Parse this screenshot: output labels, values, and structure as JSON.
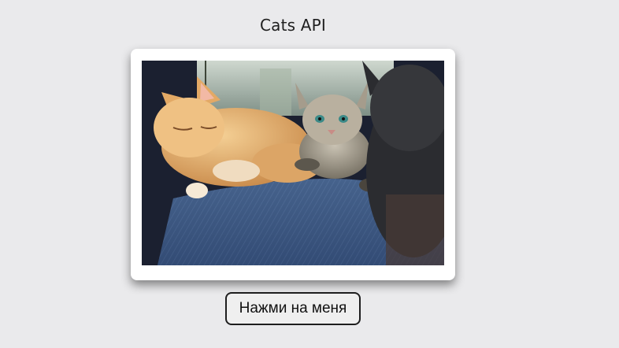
{
  "page": {
    "title": "Cats API"
  },
  "image": {
    "description_icon": "cat-photo"
  },
  "actions": {
    "button_label": "Нажми на меня"
  },
  "colors": {
    "background": "#eaeaec",
    "card": "#ffffff",
    "button_border": "#1e1e1e"
  }
}
